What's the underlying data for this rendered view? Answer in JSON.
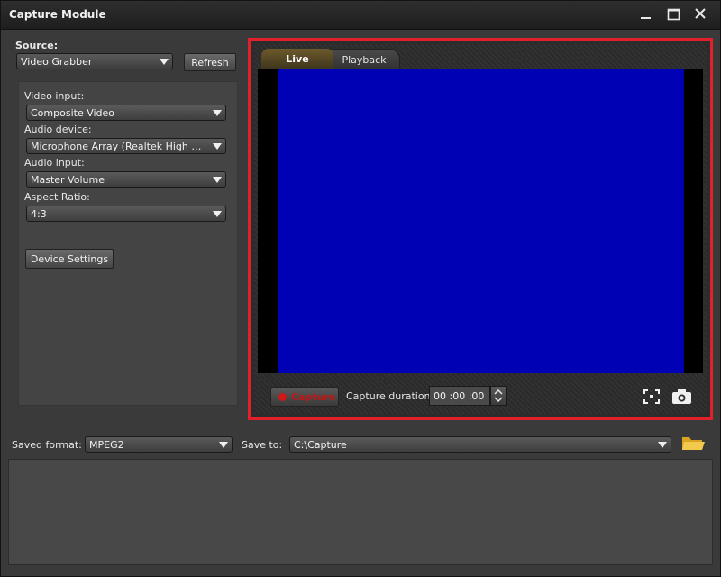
{
  "window": {
    "title": "Capture Module"
  },
  "source": {
    "label": "Source:",
    "value": "Video Grabber",
    "refresh_label": "Refresh"
  },
  "device": {
    "video_input_label": "Video input:",
    "video_input_value": "Composite Video",
    "audio_device_label": "Audio device:",
    "audio_device_value": "Microphone Array (Realtek High Definiti...",
    "audio_input_label": "Audio input:",
    "audio_input_value": "Master Volume",
    "aspect_ratio_label": "Aspect Ratio:",
    "aspect_ratio_value": "4:3",
    "settings_label": "Device Settings"
  },
  "preview": {
    "tabs": [
      {
        "label": "Live",
        "active": true
      },
      {
        "label": "Playback",
        "active": false
      }
    ],
    "video_color": "#0000b4",
    "highlight_color": "#e0202a"
  },
  "controls": {
    "capture_label": "Capture",
    "duration_label": "Capture duration:",
    "duration_value": "00 :00 :00",
    "icons": [
      "fullscreen-icon",
      "camera-icon"
    ]
  },
  "output": {
    "format_label": "Saved format:",
    "format_value": "MPEG2",
    "save_to_label": "Save to:",
    "save_to_value": "C:\\Capture",
    "folder_icon": "folder-icon"
  }
}
